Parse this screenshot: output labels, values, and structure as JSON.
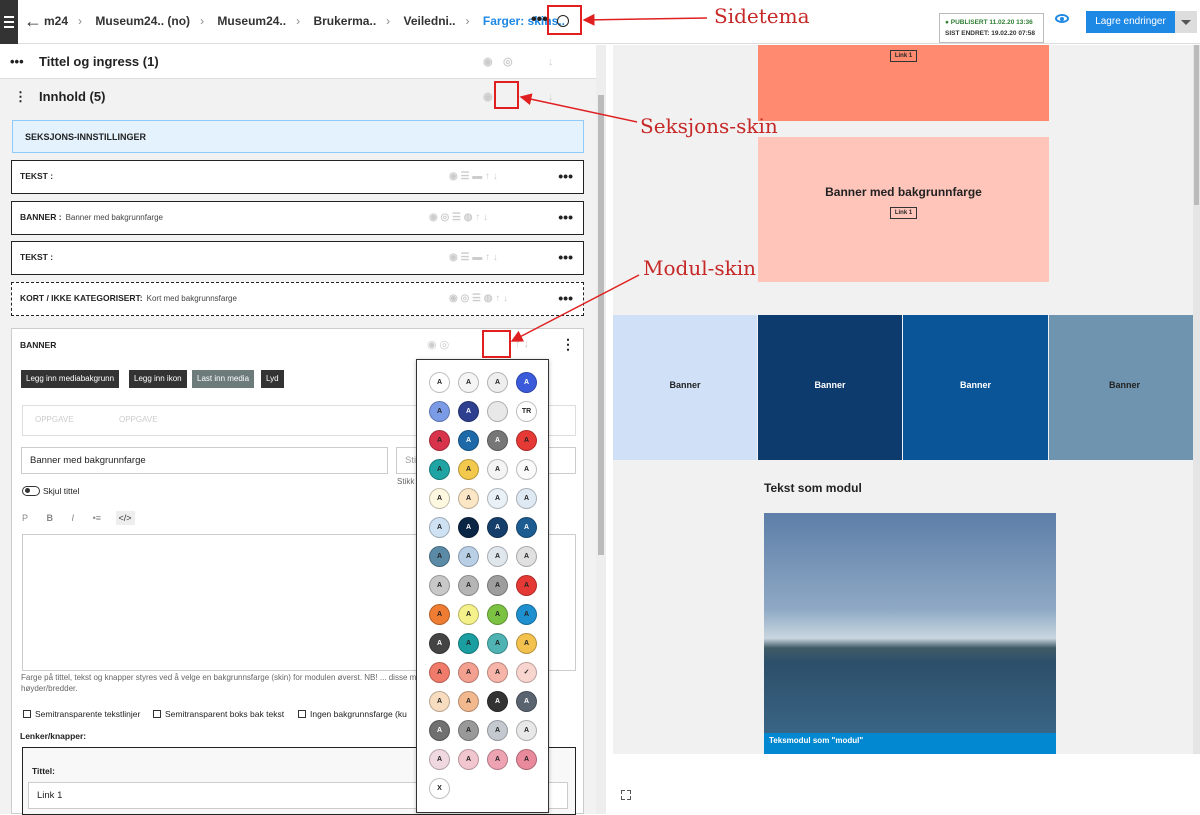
{
  "header": {
    "crumbs": [
      "m24",
      "Museum24.. (no)",
      "Museum24..",
      "Brukerma..",
      "Veiledni..",
      "Farger: skins.."
    ],
    "status_published": "PUBLISERT 11.02.20 13:36",
    "status_changed": "SIST ENDRET: 19.02.20 07:58",
    "save_label": "Lagre endringer"
  },
  "sections": [
    {
      "label": "Tittel og ingress (1)"
    },
    {
      "label": "Innhold (5)"
    }
  ],
  "settings_label": "SEKSJONS-INNSTILLINGER",
  "modules": [
    {
      "type": "TEKST :",
      "sub": ""
    },
    {
      "type": "BANNER :",
      "sub": "Banner med bakgrunnfarge"
    },
    {
      "type": "TEKST :",
      "sub": ""
    },
    {
      "type": "KORT / IKKE KATEGORISERT:",
      "sub": "Kort med bakgrunnsfarge"
    }
  ],
  "editor": {
    "title": "BANNER",
    "buttons": [
      "Legg inn mediabakgrunn",
      "Legg inn ikon",
      "Last inn media",
      "Lyd"
    ],
    "toolbar_items": [
      "OPPGAVE",
      "OPPGAVE"
    ],
    "title_value": "Banner med bakgrunnfarge",
    "subtitle_placeholder": "Sti",
    "subtitle_hint": "Stikk",
    "hide_title": "Skjul tittel",
    "rte_tools": [
      "P",
      "B",
      "I",
      "•≡",
      "</>"
    ],
    "help": "Farge på tittel, tekst og knapper styres ved å velge en bakgrunnsfarge (skin) for modulen øverst. NB! ... disse modulene, da de har faste høyder/bredder.",
    "checkboxes": [
      "Semitransparente tekstlinjer",
      "Semitransparent boks bak tekst",
      "Ingen bakgrunnsfarge (ku"
    ],
    "links_label": "Lenker/knapper:",
    "link_title_label": "Tittel:",
    "link_value": "Link 1"
  },
  "picker": {
    "swatches": [
      {
        "t": "A",
        "c": "#ffffff"
      },
      {
        "t": "A",
        "c": "#f5f5f5"
      },
      {
        "t": "A",
        "c": "#eeeeee"
      },
      {
        "t": "A",
        "c": "#3b5bdb"
      },
      {
        "t": "A",
        "c": "#7b9be6"
      },
      {
        "t": "A",
        "c": "#2f3f8f"
      },
      {
        "t": "",
        "c": "#e8e8e8"
      },
      {
        "t": "TR",
        "c": "#ffffff"
      },
      {
        "t": "A",
        "c": "#d8334a"
      },
      {
        "t": "A",
        "c": "#1e6aa8"
      },
      {
        "t": "A",
        "c": "#777777"
      },
      {
        "t": "A",
        "c": "#e53935"
      },
      {
        "t": "A",
        "c": "#1fa3a3"
      },
      {
        "t": "A",
        "c": "#f2c94c"
      },
      {
        "t": "A",
        "c": "#f4f4f4"
      },
      {
        "t": "A",
        "c": "#fafafa"
      },
      {
        "t": "A",
        "c": "#fff8e1"
      },
      {
        "t": "A",
        "c": "#fbe7c6"
      },
      {
        "t": "A",
        "c": "#e9f1f7"
      },
      {
        "t": "A",
        "c": "#dfe9f3"
      },
      {
        "t": "A",
        "c": "#cfe2f3"
      },
      {
        "t": "A",
        "c": "#0b2545"
      },
      {
        "t": "A",
        "c": "#163e6b"
      },
      {
        "t": "A",
        "c": "#1c5c91"
      },
      {
        "t": "A",
        "c": "#5b8aa6"
      },
      {
        "t": "A",
        "c": "#b8cfe6"
      },
      {
        "t": "A",
        "c": "#dfe6ec"
      },
      {
        "t": "A",
        "c": "#e0e0e0"
      },
      {
        "t": "A",
        "c": "#c8c8c8"
      },
      {
        "t": "A",
        "c": "#b5b5b5"
      },
      {
        "t": "A",
        "c": "#9e9e9e"
      },
      {
        "t": "A",
        "c": "#e53935"
      },
      {
        "t": "A",
        "c": "#ee7d33"
      },
      {
        "t": "A",
        "c": "#f4f08a"
      },
      {
        "t": "A",
        "c": "#7cc242"
      },
      {
        "t": "A",
        "c": "#1e8fcf"
      },
      {
        "t": "A",
        "c": "#444444"
      },
      {
        "t": "A",
        "c": "#1a9ea0"
      },
      {
        "t": "A",
        "c": "#4fb3b3"
      },
      {
        "t": "A",
        "c": "#f2c14e"
      },
      {
        "t": "A",
        "c": "#f07b6a"
      },
      {
        "t": "A",
        "c": "#f4a090"
      },
      {
        "t": "A",
        "c": "#f6b5a8"
      },
      {
        "t": "✓",
        "c": "#f9d5cf"
      },
      {
        "t": "A",
        "c": "#f7dcc0"
      },
      {
        "t": "A",
        "c": "#f2b98f"
      },
      {
        "t": "A",
        "c": "#333333"
      },
      {
        "t": "A",
        "c": "#5a6470"
      },
      {
        "t": "A",
        "c": "#707070"
      },
      {
        "t": "A",
        "c": "#999999"
      },
      {
        "t": "A",
        "c": "#c4c9d0"
      },
      {
        "t": "A",
        "c": "#e8e8e8"
      },
      {
        "t": "A",
        "c": "#f0d8e0"
      },
      {
        "t": "A",
        "c": "#f2c6ce"
      },
      {
        "t": "A",
        "c": "#eda3b2"
      },
      {
        "t": "A",
        "c": "#e88a9b"
      },
      {
        "t": "X",
        "c": "#ffffff"
      }
    ]
  },
  "annotations": {
    "sidetema": "Sidetema",
    "seksjon": "Seksjons-skin",
    "modul": "Modul-skin"
  },
  "preview": {
    "top_link": "Link 1",
    "banner_title": "Banner med bakgrunnfarge",
    "banner_link": "Link 1",
    "tiles": [
      "Banner",
      "Banner",
      "Banner",
      "Banner"
    ],
    "text_module": "Tekst som modul",
    "caption": "Teksmodul som \"modul\""
  },
  "colors": {
    "accent": "#1e88e5",
    "annotation": "#e02020",
    "banner_salmon": "#ff8a70",
    "banner_pink": "#ffc5bb",
    "tile1": "#cfe0f7",
    "tile2": "#0d3b6e",
    "tile3": "#0a5597",
    "tile4": "#6e94b0"
  }
}
